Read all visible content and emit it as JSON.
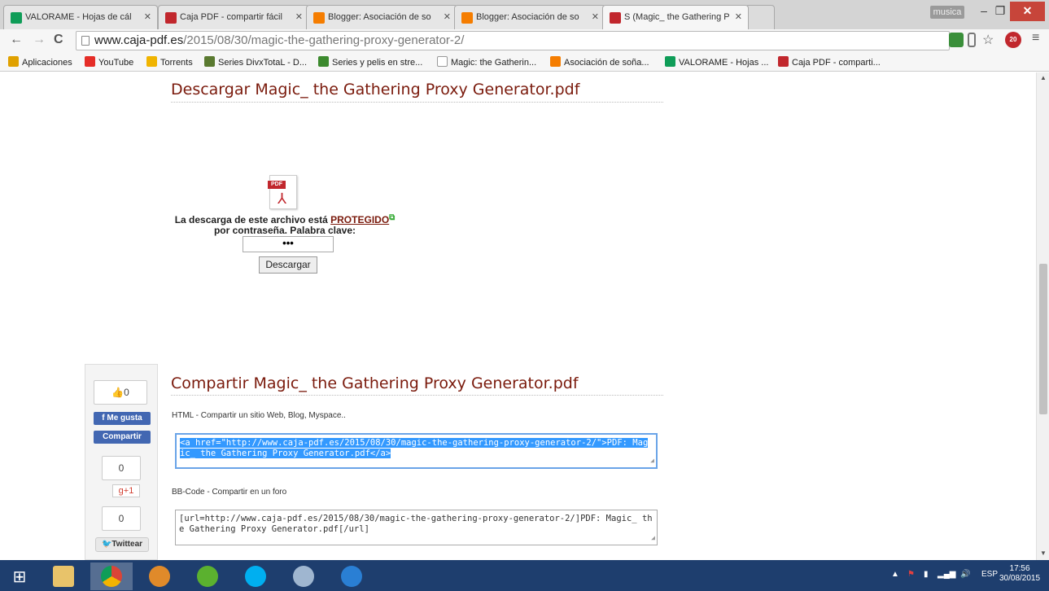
{
  "browser": {
    "tabs": [
      {
        "title": "VALORAME - Hojas de cál",
        "icon": "sheets-icon",
        "color": "#0f9d58"
      },
      {
        "title": "Caja PDF - compartir fácil",
        "icon": "pdf-icon",
        "color": "#c1272d"
      },
      {
        "title": "Blogger: Asociación de so",
        "icon": "blogger-icon",
        "color": "#f57d00"
      },
      {
        "title": "Blogger: Asociación de so",
        "icon": "blogger-icon",
        "color": "#f57d00"
      },
      {
        "title": "S (Magic_ the Gathering P",
        "icon": "pdf-icon",
        "color": "#c1272d",
        "active": true
      }
    ],
    "user_badge": "musica",
    "url_host": "www.caja-pdf.es",
    "url_path": "/2015/08/30/magic-the-gathering-proxy-generator-2/",
    "abp_count": "20",
    "bookmarks": [
      {
        "label": "Aplicaciones",
        "icon": "apps-icon",
        "color": "#e0a100"
      },
      {
        "label": "YouTube",
        "icon": "youtube-icon",
        "color": "#e52d27"
      },
      {
        "label": "Torrents",
        "icon": "folder-icon",
        "color": "#f0b400"
      },
      {
        "label": "Series DivxTotaL - D...",
        "icon": "divx-icon",
        "color": "#5a7a30"
      },
      {
        "label": "Series y pelis en stre...",
        "icon": "p-icon",
        "color": "#3c8a2e"
      },
      {
        "label": "Magic: the Gatherin...",
        "icon": "page-icon",
        "color": "#ffffff"
      },
      {
        "label": "Asociación de soña...",
        "icon": "blogger-icon",
        "color": "#f57d00"
      },
      {
        "label": "VALORAME - Hojas ...",
        "icon": "sheets-icon",
        "color": "#0f9d58"
      },
      {
        "label": "Caja PDF - comparti...",
        "icon": "pdf-icon",
        "color": "#c1272d"
      }
    ]
  },
  "page": {
    "download_title": "Descargar Magic_ the Gathering Proxy Generator.pdf",
    "protected_text_before": "La descarga de este archivo está ",
    "protected_link": "PROTEGIDO",
    "protected_text_after": "por contraseña. Palabra clave:",
    "password_value": "•••",
    "download_button": "Descargar",
    "share_title": "Compartir Magic_ the Gathering Proxy Generator.pdf",
    "html_label": "HTML - Compartir un sitio Web, Blog, Myspace..",
    "html_code": "<a href=\"http://www.caja-pdf.es/2015/08/30/magic-the-gathering-proxy-generator-2/\">PDF: Magic_ the Gathering Proxy Generator.pdf</a>",
    "bbcode_label": "BB-Code - Compartir en un foro",
    "bbcode_code": "[url=http://www.caja-pdf.es/2015/08/30/magic-the-gathering-proxy-generator-2/]PDF: Magic_ the Gathering Proxy Generator.pdf[/url]"
  },
  "share": {
    "fb_count": "0",
    "fb_like": "Me gusta",
    "fb_share": "Compartir",
    "gplus_count": "0",
    "gplus_label": "g+1",
    "twitter_count": "0",
    "twitter_label": "Twittear"
  },
  "taskbar": {
    "lang": "ESP",
    "time": "17:56",
    "date": "30/08/2015"
  }
}
